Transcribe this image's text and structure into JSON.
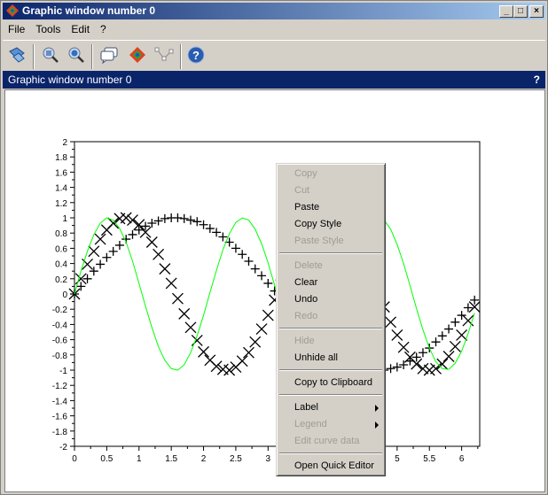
{
  "window": {
    "title": "Graphic window number 0",
    "minimize_label": "_",
    "maximize_label": "□",
    "close_label": "×"
  },
  "menubar": [
    "File",
    "Tools",
    "Edit",
    "?"
  ],
  "toolbar": [
    "rotate-icon",
    "zoom-icon",
    "zoom-reset-icon",
    "datatip-icon",
    "scilab-icon",
    "polyline-editor-icon",
    "help-icon"
  ],
  "header": {
    "title": "Graphic window number 0",
    "help": "?"
  },
  "context_menu": [
    {
      "label": "Copy",
      "enabled": false
    },
    {
      "label": "Cut",
      "enabled": false
    },
    {
      "label": "Paste",
      "enabled": true
    },
    {
      "label": "Copy Style",
      "enabled": true
    },
    {
      "label": "Paste Style",
      "enabled": false
    },
    {
      "sep": true
    },
    {
      "label": "Delete",
      "enabled": false
    },
    {
      "label": "Clear",
      "enabled": true
    },
    {
      "label": "Undo",
      "enabled": true
    },
    {
      "label": "Redo",
      "enabled": false
    },
    {
      "sep": true
    },
    {
      "label": "Hide",
      "enabled": false
    },
    {
      "label": "Unhide all",
      "enabled": true
    },
    {
      "sep": true
    },
    {
      "label": "Copy to Clipboard",
      "enabled": true
    },
    {
      "sep": true
    },
    {
      "label": "Label",
      "enabled": true,
      "submenu": true
    },
    {
      "label": "Legend",
      "enabled": false,
      "submenu": true
    },
    {
      "label": "Edit curve data",
      "enabled": false
    },
    {
      "sep": true
    },
    {
      "label": "Open Quick Editor",
      "enabled": true
    }
  ],
  "chart_data": {
    "type": "line",
    "xlim": [
      0,
      6.28
    ],
    "ylim": [
      -2,
      2
    ],
    "xticks": [
      "0",
      "0.5",
      "1",
      "1.5",
      "2",
      "2.5",
      "3",
      "3.5",
      "4",
      "4.5",
      "5",
      "5.5",
      "6"
    ],
    "yticks": [
      "-2",
      "-1.8",
      "-1.6",
      "-1.4",
      "-1.2",
      "-1",
      "-0.8",
      "-0.6",
      "-0.4",
      "-0.2",
      "0",
      "0.2",
      "0.4",
      "0.6",
      "0.8",
      "1",
      "1.2",
      "1.4",
      "1.6",
      "1.8",
      "2"
    ],
    "x": [
      0,
      0.1,
      0.2,
      0.3,
      0.4,
      0.5,
      0.6,
      0.7,
      0.8,
      0.9,
      1,
      1.1,
      1.2,
      1.3,
      1.4,
      1.5,
      1.6,
      1.7,
      1.8,
      1.9,
      2,
      2.1,
      2.2,
      2.3,
      2.4,
      2.5,
      2.6,
      2.7,
      2.8,
      2.9,
      3,
      3.1,
      3.2,
      3.3,
      3.4,
      3.5,
      3.6,
      3.7,
      3.8,
      3.9,
      4,
      4.1,
      4.2,
      4.3,
      4.4,
      4.5,
      4.6,
      4.7,
      4.8,
      4.9,
      5,
      5.1,
      5.2,
      5.3,
      5.4,
      5.5,
      5.6,
      5.7,
      5.8,
      5.9,
      6,
      6.1,
      6.2
    ],
    "series": [
      {
        "style": "plus-markers",
        "color": "#000000",
        "values": [
          0,
          0.1,
          0.2,
          0.3,
          0.39,
          0.48,
          0.56,
          0.64,
          0.72,
          0.78,
          0.84,
          0.89,
          0.93,
          0.96,
          0.99,
          1.0,
          1.0,
          0.99,
          0.97,
          0.95,
          0.91,
          0.86,
          0.81,
          0.75,
          0.68,
          0.6,
          0.52,
          0.43,
          0.33,
          0.24,
          0.14,
          0.04,
          -0.06,
          -0.16,
          -0.26,
          -0.35,
          -0.44,
          -0.53,
          -0.61,
          -0.69,
          -0.76,
          -0.82,
          -0.87,
          -0.92,
          -0.95,
          -0.98,
          -0.99,
          -1.0,
          -1.0,
          -0.98,
          -0.96,
          -0.93,
          -0.88,
          -0.83,
          -0.77,
          -0.71,
          -0.63,
          -0.55,
          -0.46,
          -0.37,
          -0.28,
          -0.18,
          -0.08
        ]
      },
      {
        "style": "cross-markers",
        "color": "#000000",
        "values": [
          0,
          0.2,
          0.39,
          0.56,
          0.72,
          0.84,
          0.93,
          0.99,
          1.0,
          0.97,
          0.91,
          0.81,
          0.68,
          0.52,
          0.33,
          0.14,
          -0.06,
          -0.26,
          -0.44,
          -0.61,
          -0.76,
          -0.87,
          -0.95,
          -0.99,
          -1.0,
          -0.96,
          -0.88,
          -0.77,
          -0.63,
          -0.46,
          -0.28,
          -0.08,
          0.12,
          0.31,
          0.49,
          0.66,
          0.79,
          0.9,
          0.97,
          1.0,
          0.99,
          0.94,
          0.85,
          0.73,
          0.58,
          0.41,
          0.22,
          0.02,
          -0.17,
          -0.37,
          -0.54,
          -0.7,
          -0.83,
          -0.92,
          -0.98,
          -1.0,
          -0.98,
          -0.92,
          -0.82,
          -0.69,
          -0.54,
          -0.35,
          -0.17
        ]
      },
      {
        "style": "line",
        "color": "#00ff00",
        "values": [
          0,
          0.3,
          0.56,
          0.78,
          0.93,
          1.0,
          0.97,
          0.86,
          0.68,
          0.43,
          0.14,
          -0.16,
          -0.44,
          -0.69,
          -0.87,
          -0.98,
          -1.0,
          -0.93,
          -0.77,
          -0.55,
          -0.28,
          0.02,
          0.31,
          0.58,
          0.79,
          0.94,
          1.0,
          0.97,
          0.85,
          0.66,
          0.41,
          0.12,
          -0.17,
          -0.46,
          -0.7,
          -0.88,
          -0.98,
          -0.99,
          -0.92,
          -0.76,
          -0.54,
          -0.26,
          0.03,
          0.33,
          0.59,
          0.8,
          0.94,
          1.0,
          0.97,
          0.85,
          0.65,
          0.4,
          0.11,
          -0.19,
          -0.47,
          -0.71,
          -0.89,
          -0.98,
          -0.99,
          -0.91,
          -0.75,
          -0.52,
          -0.25
        ]
      }
    ]
  }
}
